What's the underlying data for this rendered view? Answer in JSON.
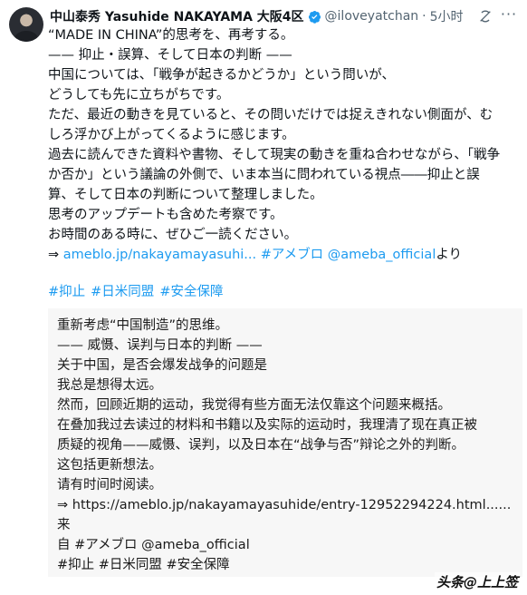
{
  "author": {
    "display_name": "中山泰秀 Yasuhide NAKAYAMA 大阪4区",
    "handle": "@iloveyatchan",
    "separator": "·",
    "time": "5小时"
  },
  "tweet": {
    "lines": [
      "“MADE IN CHINA”的思考を、再考する。",
      "—— 抑止・誤算、そして日本の判断 ——",
      "",
      "中国については、「戦争が起きるかどうか」という問いが、",
      "どうしても先に立ちがちです。",
      "ただ、最近の動きを見ていると、その問いだけでは捉えきれない側面が、む",
      "しろ浮かび上がってくるように感じます。",
      "過去に読んできた資料や書物、そして現実の動きを重ね合わせながら、「戦争",
      "か否か」という議論の外側で、いま本当に問われている視点――抑止と誤",
      "算、そして日本の判断について整理しました。",
      "思考のアップデートも含めた考察です。",
      "お時間のある時に、ぜひご一読ください。"
    ],
    "link_prefix": "⇒ ",
    "link": "ameblo.jp/nakayamayasuhi...",
    "link_tags": " #アメブロ @ameba_official",
    "link_suffix": "より",
    "hashtags": [
      "#抑止",
      "#日米同盟",
      "#安全保障"
    ]
  },
  "translation": {
    "lines": [
      "重新考虑“中国制造”的思维。",
      "—— 威慑、误判与日本的判断 ——",
      "",
      "关于中国，是否会爆发战争的问题是",
      "我总是想得太远。",
      "然而，回顾近期的运动，我觉得有些方面无法仅靠这个问题来概括。",
      "在叠加我过去读过的材料和书籍以及实际的运动时，我理清了现在真正被",
      "质疑的视角——威慑、误判，以及日本在“战争与否”辩论之外的判断。",
      "这包括更新想法。",
      "请有时间时阅读。",
      "⇒ https://ameblo.jp/nakayamayasuhide/entry-12952294224.html......来",
      "自 #アメブロ @ameba_official",
      "",
      "#抑止 #日米同盟 #安全保障"
    ]
  },
  "watermark": "头条@上上签",
  "icons": {
    "verified": "verified-badge-icon",
    "grok": "grok-icon",
    "more": "more-options-icon"
  },
  "colors": {
    "link": "#1d9bf0",
    "verified": "#1d9bf0",
    "muted": "#536471",
    "translation_bg": "#f7f7f7"
  }
}
